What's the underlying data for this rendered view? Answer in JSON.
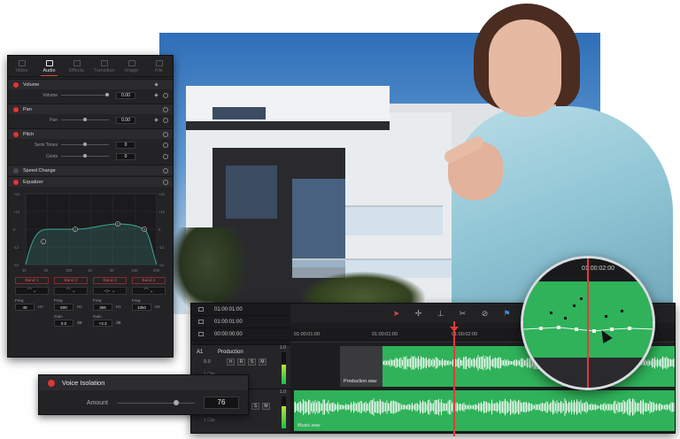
{
  "inspector": {
    "tabs": [
      {
        "label": "Video",
        "icon": "video-icon",
        "active": false
      },
      {
        "label": "Audio",
        "icon": "music-note-icon",
        "active": true
      },
      {
        "label": "Effects",
        "icon": "effects-icon",
        "active": false
      },
      {
        "label": "Transition",
        "icon": "transition-icon",
        "active": false
      },
      {
        "label": "Image",
        "icon": "image-icon",
        "active": false
      },
      {
        "label": "File",
        "icon": "file-icon",
        "active": false
      }
    ],
    "volume": {
      "title": "Volume",
      "param": "Volume",
      "value": "0.00"
    },
    "pan": {
      "title": "Pan",
      "param": "Pan",
      "value": "0.00"
    },
    "pitch": {
      "title": "Pitch",
      "semitones_label": "Semi Tones",
      "semitones": "0",
      "cents_label": "Cents",
      "cents": "0"
    },
    "speed_change": {
      "title": "Speed Change"
    },
    "equalizer": {
      "title": "Equalizer",
      "y_ticks_left": [
        "+24",
        "+12",
        "0",
        "-12",
        "-24"
      ],
      "y_ticks_right": [
        "+24",
        "+12",
        "0",
        "-12",
        "-24"
      ],
      "x_ticks": [
        "30",
        "60",
        "300",
        "1K",
        "3K",
        "10K",
        "20K"
      ],
      "curve_color": "#3fa79a",
      "bands": [
        {
          "label": "Band 1",
          "freq_label": "Freq",
          "freq": "49"
        },
        {
          "label": "Band 2",
          "freq_label": "Freq",
          "freq": "500",
          "gain_label": "Gain",
          "gain": "0.0"
        },
        {
          "label": "Band 3",
          "freq_label": "Freq",
          "freq": "3k6",
          "gain_label": "Gain",
          "gain": "+3.3"
        },
        {
          "label": "Band 4",
          "freq_label": "Freq",
          "freq": "10k0"
        }
      ],
      "node_labels": [
        "1",
        "2",
        "3",
        "4"
      ],
      "freq_units": [
        "Hz",
        "Hz",
        "Hz",
        "Hz"
      ],
      "gain_units": [
        "dB",
        "dB"
      ]
    }
  },
  "voice_isolation": {
    "title": "Voice Isolation",
    "amount_label": "Amount",
    "amount": "76",
    "amount_fraction": 0.76
  },
  "timeline": {
    "timecodes": [
      "01:00:01:00",
      "01:00:01:00",
      "00:00:00:00"
    ],
    "ruler": [
      "01:00:01:00",
      "01:00:01:00",
      "01:00:02:00"
    ],
    "tracks": [
      {
        "id": "A1",
        "name": "Production",
        "volume": "0.0",
        "buttons": [
          "R",
          "S",
          "M"
        ],
        "clips_label": "1 Clip",
        "level": "1.0"
      },
      {
        "id": "A2",
        "name": "",
        "volume": "",
        "buttons": [
          "R",
          "S",
          "M"
        ],
        "clips_label": "1 Clip",
        "level": "1.0"
      }
    ],
    "clips": [
      {
        "name": "Production.wav"
      },
      {
        "name": "Music.wav"
      }
    ],
    "accent": "#2fb25a",
    "playhead_color": "#e43a3a"
  },
  "magnifier": {
    "timecode": "01:00:02:00"
  }
}
